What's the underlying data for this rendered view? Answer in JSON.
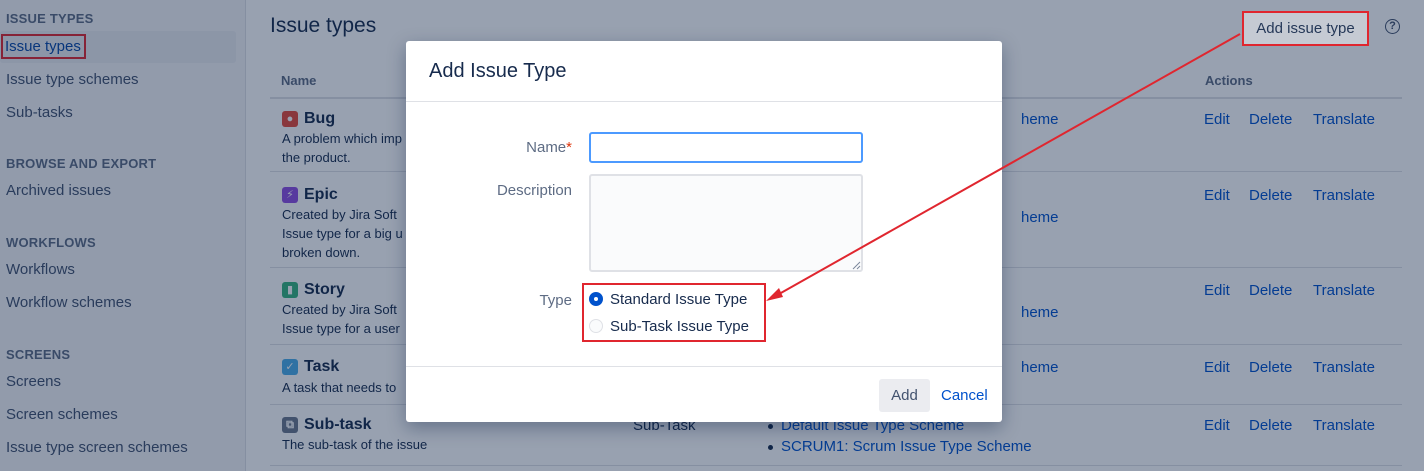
{
  "sidebar": {
    "sections": [
      {
        "heading": "ISSUE TYPES",
        "items": [
          "Issue types",
          "Issue type schemes",
          "Sub-tasks"
        ]
      },
      {
        "heading": "BROWSE AND EXPORT",
        "items": [
          "Archived issues"
        ]
      },
      {
        "heading": "WORKFLOWS",
        "items": [
          "Workflows",
          "Workflow schemes"
        ]
      },
      {
        "heading": "SCREENS",
        "items": [
          "Screens",
          "Screen schemes",
          "Issue type screen schemes"
        ]
      }
    ],
    "active_item": "Issue types"
  },
  "main": {
    "title": "Issue types",
    "add_button_label": "Add issue type",
    "help_glyph": "?",
    "columns": {
      "name": "Name",
      "actions": "Actions"
    },
    "rows": [
      {
        "name": "Bug",
        "icon": "bug-icon",
        "icon_color": "#e5493a",
        "icon_glyph": "●",
        "desc_lines": [
          "A problem which imp",
          "the product."
        ],
        "type": "",
        "schemes": [
          "heme"
        ],
        "actions": [
          "Edit",
          "Delete",
          "Translate"
        ]
      },
      {
        "name": "Epic",
        "icon": "epic-icon",
        "icon_color": "#904ee2",
        "icon_glyph": "⚡",
        "desc_lines": [
          "Created by Jira Soft",
          "Issue type for a big u",
          "broken down."
        ],
        "type": "",
        "schemes": [
          "heme"
        ],
        "actions": [
          "Edit",
          "Delete",
          "Translate"
        ]
      },
      {
        "name": "Story",
        "icon": "story-icon",
        "icon_color": "#36b37e",
        "icon_glyph": "▮",
        "desc_lines": [
          "Created by Jira Soft",
          "Issue type for a user"
        ],
        "type": "",
        "schemes": [
          "heme"
        ],
        "actions": [
          "Edit",
          "Delete",
          "Translate"
        ]
      },
      {
        "name": "Task",
        "icon": "task-checkbox-icon",
        "icon_color": "#4bade8",
        "icon_glyph": "✓",
        "desc_lines": [
          "A task that needs to"
        ],
        "type": "",
        "schemes": [
          "heme"
        ],
        "actions": [
          "Edit",
          "Delete",
          "Translate"
        ]
      },
      {
        "name": "Sub-task",
        "icon": "subtask-icon",
        "icon_color": "#6b778c",
        "icon_glyph": "⧉",
        "desc_lines": [
          "The sub-task of the issue"
        ],
        "type": "Sub-Task",
        "schemes": [
          "Default Issue Type Scheme",
          "SCRUM1: Scrum Issue Type Scheme"
        ],
        "actions": [
          "Edit",
          "Delete",
          "Translate"
        ]
      }
    ]
  },
  "dialog": {
    "title": "Add Issue Type",
    "name_label": "Name",
    "required_mark": "*",
    "name_value": "",
    "description_label": "Description",
    "description_value": "",
    "type_label": "Type",
    "type_options": [
      {
        "label": "Standard Issue Type",
        "selected": true
      },
      {
        "label": "Sub-Task Issue Type",
        "selected": false
      }
    ],
    "add_label": "Add",
    "cancel_label": "Cancel"
  },
  "annotation_color": "#e0262f",
  "link_color": "#0052cc"
}
